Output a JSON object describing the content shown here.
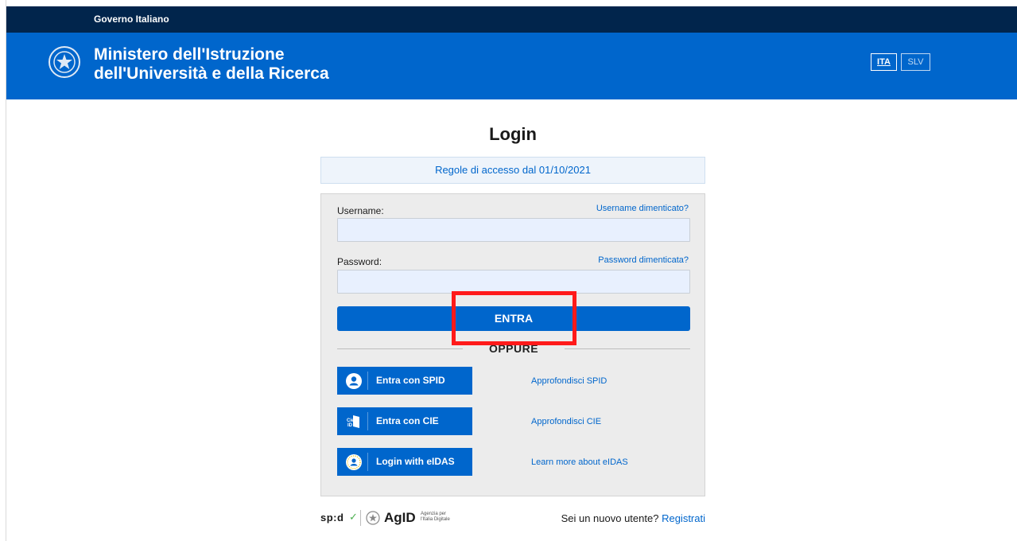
{
  "topbar": {
    "label": "Governo Italiano"
  },
  "header": {
    "title_line1": "Ministero dell'Istruzione",
    "title_line2": "dell'Università e della Ricerca",
    "lang_ita": "ITA",
    "lang_slv": "SLV"
  },
  "login": {
    "title": "Login",
    "rules_link": "Regole di accesso dal 01/10/2021",
    "username_label": "Username:",
    "username_forgot": "Username dimenticato?",
    "username_value": "",
    "password_label": "Password:",
    "password_forgot": "Password dimenticata?",
    "password_value": "",
    "submit_label": "ENTRA",
    "or_label": "OPPURE"
  },
  "auth_options": [
    {
      "label": "Entra con SPID",
      "learn": "Approfondisci SPID",
      "icon": "user-circle-icon"
    },
    {
      "label": "Entra con CIE",
      "learn": "Approfondisci CIE",
      "icon": "cie-id-card-icon"
    },
    {
      "label": "Login with eIDAS",
      "learn": "Learn more about eIDAS",
      "icon": "eidas-user-icon"
    }
  ],
  "footer": {
    "spid_logo": "sp:d",
    "agid_logo": "AgID",
    "agid_tagline": "Agenzia per l'Italia Digitale",
    "new_user_text": "Sei un nuovo utente?",
    "register_link": "Registrati"
  },
  "colors": {
    "topbar": "#01254c",
    "brand_blue": "#0066cc",
    "panel_bg": "#ececec",
    "highlight": "#ff1a1a"
  }
}
